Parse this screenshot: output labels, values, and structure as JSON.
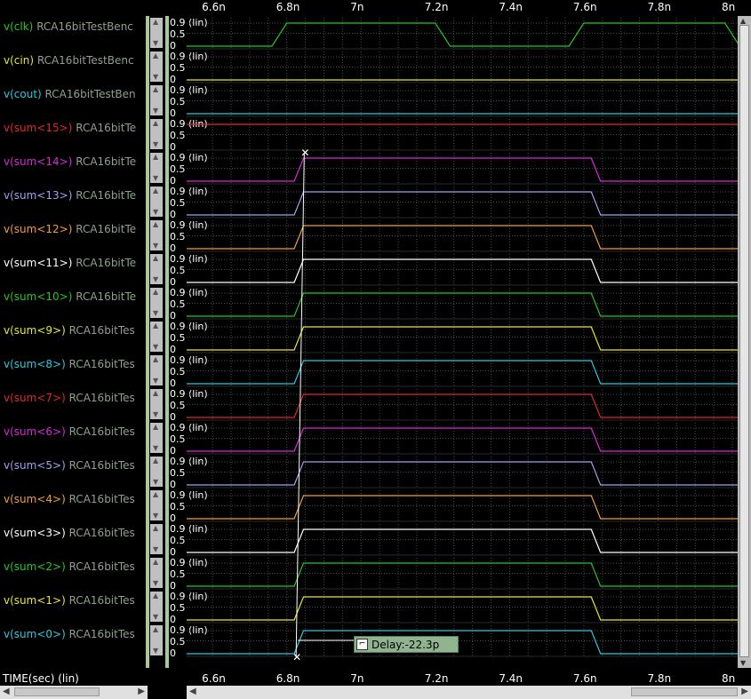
{
  "x_axis": {
    "label": "TIME(sec) (lin)",
    "ticks": [
      "6.6n",
      "6.8n",
      "7n",
      "7.2n",
      "7.4n",
      "7.6n",
      "7.8n",
      "8n"
    ]
  },
  "y_axis_labels": {
    "top": "0.9",
    "mid": "0.5",
    "zero": "0",
    "scale": "(lin)"
  },
  "signals": [
    {
      "name": "v(clk)",
      "dataset": "RCA16bitTestBenc",
      "color": "#22c822",
      "waveform": "clk"
    },
    {
      "name": "v(cin)",
      "dataset": "RCA16bitTestBenc",
      "color": "#e8e828",
      "waveform": "low"
    },
    {
      "name": "v(cout)",
      "dataset": "RCA16bitTestBen",
      "color": "#28c8e0",
      "waveform": "low"
    },
    {
      "name": "v(sum<15>)",
      "dataset": "RCA16bitTe",
      "color": "#e02828",
      "waveform": "high"
    },
    {
      "name": "v(sum<14>)",
      "dataset": "RCA16bitTe",
      "color": "#d828d8",
      "waveform": "pulse"
    },
    {
      "name": "v(sum<13>)",
      "dataset": "RCA16bitTe",
      "color": "#a0a0f0",
      "waveform": "pulse"
    },
    {
      "name": "v(sum<12>)",
      "dataset": "RCA16bitTe",
      "color": "#f0a030",
      "waveform": "pulse"
    },
    {
      "name": "v(sum<11>)",
      "dataset": "RCA16bitTe",
      "color": "#ffffff",
      "waveform": "pulse"
    },
    {
      "name": "v(sum<10>)",
      "dataset": "RCA16bitTe",
      "color": "#22c822",
      "waveform": "pulse"
    },
    {
      "name": "v(sum<9>)",
      "dataset": "RCA16bitTes",
      "color": "#e8e828",
      "waveform": "pulse"
    },
    {
      "name": "v(sum<8>)",
      "dataset": "RCA16bitTes",
      "color": "#28c8e0",
      "waveform": "pulse"
    },
    {
      "name": "v(sum<7>)",
      "dataset": "RCA16bitTes",
      "color": "#e02828",
      "waveform": "pulse"
    },
    {
      "name": "v(sum<6>)",
      "dataset": "RCA16bitTes",
      "color": "#d828d8",
      "waveform": "pulse"
    },
    {
      "name": "v(sum<5>)",
      "dataset": "RCA16bitTes",
      "color": "#a0a0f0",
      "waveform": "pulse"
    },
    {
      "name": "v(sum<4>)",
      "dataset": "RCA16bitTes",
      "color": "#f0a030",
      "waveform": "pulse"
    },
    {
      "name": "v(sum<3>)",
      "dataset": "RCA16bitTes",
      "color": "#ffffff",
      "waveform": "pulse"
    },
    {
      "name": "v(sum<2>)",
      "dataset": "RCA16bitTes",
      "color": "#22c822",
      "waveform": "pulse"
    },
    {
      "name": "v(sum<1>)",
      "dataset": "RCA16bitTes",
      "color": "#e8e828",
      "waveform": "pulse"
    },
    {
      "name": "v(sum<0>)",
      "dataset": "RCA16bitTes",
      "color": "#28c8e0",
      "waveform": "pulse"
    }
  ],
  "timing": {
    "t_min_ns": 6.535,
    "t_max_ns": 8.0,
    "clk_edges_ns": [
      6.8,
      7.2,
      7.6,
      8.0
    ],
    "sum_rise_ns": 6.82,
    "sum_fall_ns": 7.62
  },
  "measurement": {
    "label": "Delay:-22.3p",
    "t_start_ns": 6.825,
    "t_end_ns": 6.847
  },
  "colors": {
    "grid": "#4a4a4a",
    "background": "#000000",
    "rail": "#a8c8a0"
  }
}
